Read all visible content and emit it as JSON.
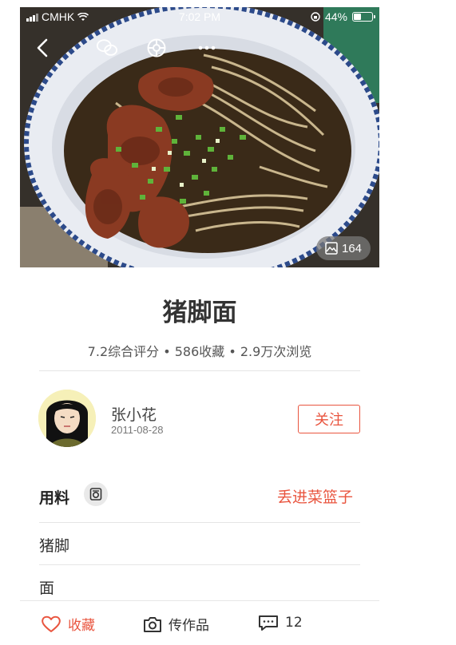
{
  "status_bar": {
    "carrier": "CMHK",
    "time": "7:02 PM",
    "battery": "44%",
    "battery_level": 0.44
  },
  "hero": {
    "photo_count": "164",
    "icons": [
      "back-icon",
      "wechat-share-icon",
      "moments-share-icon",
      "more-icon"
    ]
  },
  "recipe": {
    "title": "猪脚面",
    "stats": "7.2综合评分 • 586收藏 • 2.9万次浏览"
  },
  "author": {
    "name": "张小花",
    "date": "2011-08-28",
    "follow_label": "关注"
  },
  "ingredients": {
    "title": "用料",
    "basket_label": "丢进菜篮子",
    "items": [
      "猪脚",
      "面"
    ]
  },
  "bottom_bar": {
    "favorite_label": "收藏",
    "upload_label": "传作品",
    "comment_count": "12"
  },
  "colors": {
    "accent": "#e9553f",
    "text": "#333333",
    "divider": "#e5e5e5"
  }
}
